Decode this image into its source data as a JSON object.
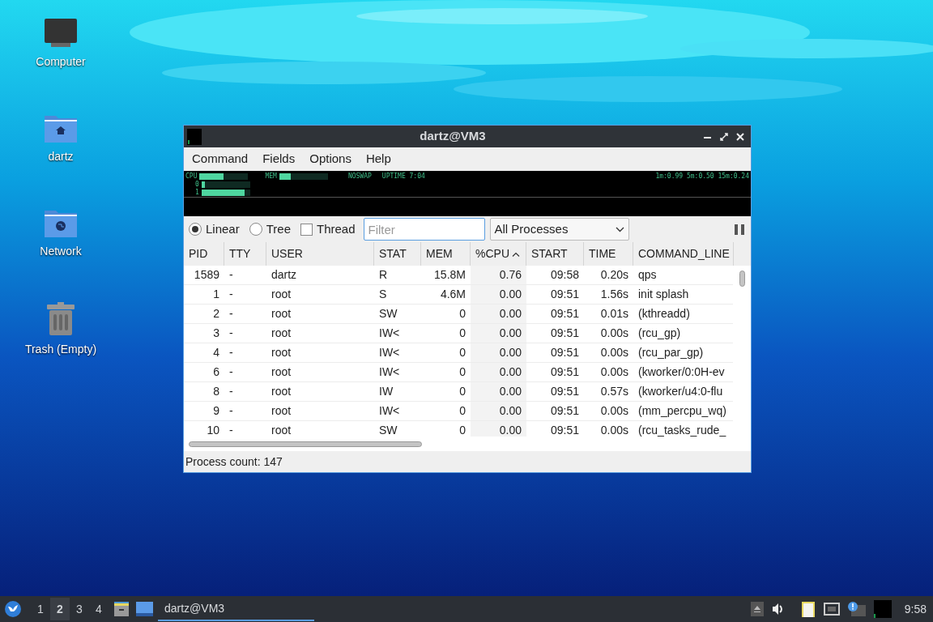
{
  "desktop_icons": [
    {
      "label": "Computer",
      "kind": "computer"
    },
    {
      "label": "dartz",
      "kind": "home"
    },
    {
      "label": "Network",
      "kind": "network"
    },
    {
      "label": "Trash (Empty)",
      "kind": "trash"
    }
  ],
  "window": {
    "title": "dartz@VM3"
  },
  "menu": [
    "Command",
    "Fields",
    "Options",
    "Help"
  ],
  "monitor": {
    "meters": [
      {
        "label": "CPU",
        "level": 0.5
      },
      {
        "label": "MEM",
        "level": 0.23
      }
    ],
    "swap": "NOSWAP",
    "uptime": "UPTIME 7:04",
    "load": "1m:0.99 5m:0.50 15m:0.24",
    "cores": [
      {
        "label": "0",
        "level": 0.06
      },
      {
        "label": "1",
        "level": 0.88
      }
    ]
  },
  "view_modes": [
    {
      "label": "Linear",
      "selected": true
    },
    {
      "label": "Tree",
      "selected": false
    }
  ],
  "thread": {
    "label": "Thread",
    "checked": false
  },
  "filter": {
    "placeholder": "Filter"
  },
  "process_filter": "All Processes",
  "table": {
    "columns": [
      {
        "label": "PID",
        "sorted": false
      },
      {
        "label": "TTY",
        "sorted": false
      },
      {
        "label": "USER",
        "sorted": false
      },
      {
        "label": "STAT",
        "sorted": false
      },
      {
        "label": "MEM",
        "sorted": false
      },
      {
        "label": "%CPU",
        "sorted": true
      },
      {
        "label": "START",
        "sorted": false
      },
      {
        "label": "TIME",
        "sorted": false
      },
      {
        "label": "COMMAND_LINE",
        "sorted": false
      }
    ],
    "rows": [
      [
        "1589",
        "-",
        "dartz",
        "R",
        "15.8M",
        "0.76",
        "09:58",
        "0.20s",
        "qps"
      ],
      [
        "1",
        "-",
        "root",
        "S",
        "4.6M",
        "0.00",
        "09:51",
        "1.56s",
        "init splash"
      ],
      [
        "2",
        "-",
        "root",
        "SW",
        "0",
        "0.00",
        "09:51",
        "0.01s",
        "(kthreadd)"
      ],
      [
        "3",
        "-",
        "root",
        "IW<",
        "0",
        "0.00",
        "09:51",
        "0.00s",
        "(rcu_gp)"
      ],
      [
        "4",
        "-",
        "root",
        "IW<",
        "0",
        "0.00",
        "09:51",
        "0.00s",
        "(rcu_par_gp)"
      ],
      [
        "6",
        "-",
        "root",
        "IW<",
        "0",
        "0.00",
        "09:51",
        "0.00s",
        "(kworker/0:0H-ev"
      ],
      [
        "8",
        "-",
        "root",
        "IW",
        "0",
        "0.00",
        "09:51",
        "0.57s",
        "(kworker/u4:0-flu"
      ],
      [
        "9",
        "-",
        "root",
        "IW<",
        "0",
        "0.00",
        "09:51",
        "0.00s",
        "(mm_percpu_wq)"
      ],
      [
        "10",
        "-",
        "root",
        "SW",
        "0",
        "0.00",
        "09:51",
        "0.00s",
        "(rcu_tasks_rude_"
      ]
    ]
  },
  "status_bar": "Process count: 147",
  "taskbar": {
    "workspaces": [
      {
        "label": "1",
        "selected": false
      },
      {
        "label": "2",
        "selected": true
      },
      {
        "label": "3",
        "selected": false
      },
      {
        "label": "4",
        "selected": false
      }
    ],
    "task": {
      "title": "dartz@VM3",
      "active": true
    },
    "clock": "9:58"
  }
}
